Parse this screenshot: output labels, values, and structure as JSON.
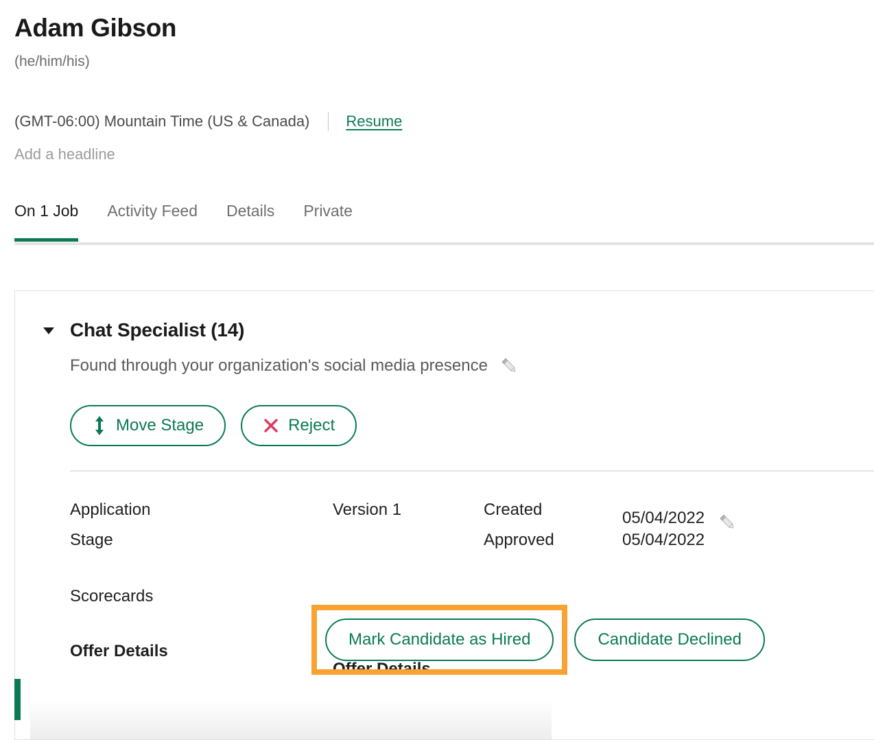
{
  "header": {
    "name": "Adam Gibson",
    "pronouns": "(he/him/his)",
    "timezone": "(GMT-06:00) Mountain Time (US & Canada)",
    "resume_label": "Resume",
    "headline_placeholder": "Add a headline"
  },
  "tabs": [
    {
      "label": "On 1 Job",
      "active": true
    },
    {
      "label": "Activity Feed",
      "active": false
    },
    {
      "label": "Details",
      "active": false
    },
    {
      "label": "Private",
      "active": false
    }
  ],
  "job_card": {
    "title": "Chat Specialist (14)",
    "source": "Found through your organization's social media presence",
    "edit_source_icon": "pencil-icon",
    "collapse_icon": "caret-down-icon",
    "actions": [
      {
        "label": "Move Stage",
        "icon": "move-vertical-arrows-icon",
        "icon_color": "#0a7a55"
      },
      {
        "label": "Reject",
        "icon": "close-x-icon",
        "icon_color": "#D93A5C"
      }
    ],
    "details": {
      "rows": [
        {
          "label": "Application",
          "version": "Version 1",
          "status": "Created",
          "date": "05/04/2022",
          "edit_icon": "pencil-icon"
        },
        {
          "label": "Stage",
          "version": "",
          "status": "Approved",
          "date": "05/04/2022",
          "edit_icon": ""
        }
      ],
      "scorecards_label": "Scorecards",
      "offer_details_label": "Offer Details",
      "offer_details_heading": "Offer Details"
    },
    "hire_actions": {
      "hired_label": "Mark Candidate as Hired",
      "declined_label": "Candidate Declined",
      "highlight_color": "#F7A233"
    }
  },
  "colors": {
    "brand_green": "#0a7a55",
    "reject_red": "#D93A5C",
    "highlight_orange": "#F7A233",
    "muted_text": "#6b6b6b"
  }
}
